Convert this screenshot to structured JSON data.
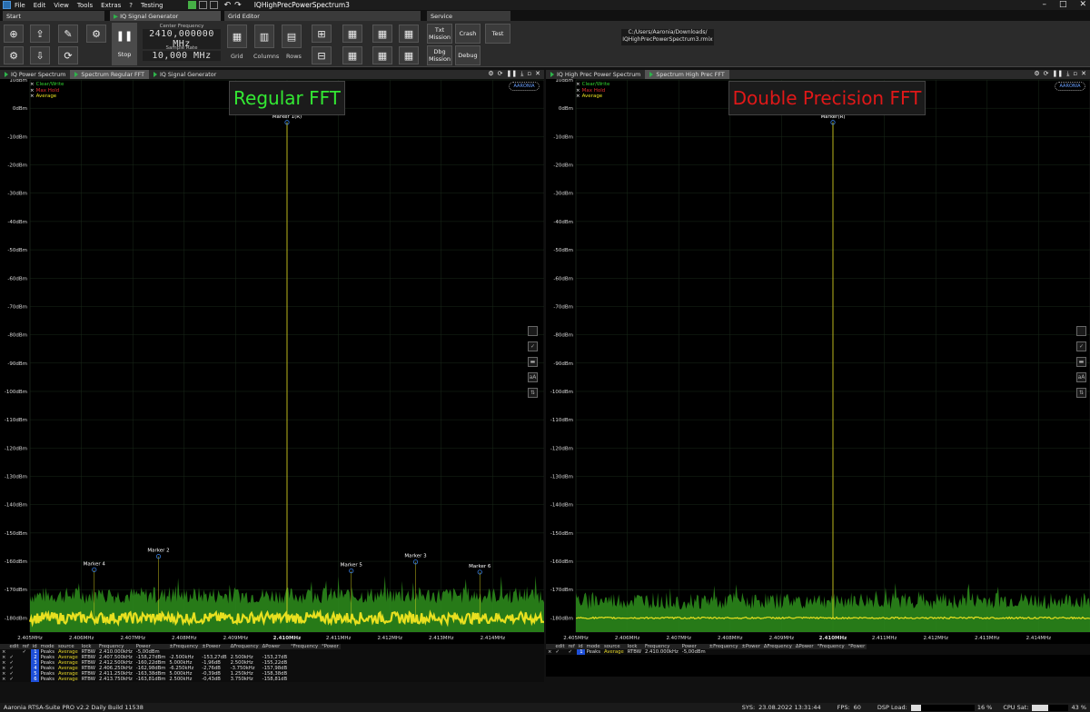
{
  "menu": {
    "items": [
      "File",
      "Edit",
      "View",
      "Tools",
      "Extras",
      "?",
      "Testing"
    ],
    "doc_title": "IQHighPrecPowerSpectrum3"
  },
  "ribbon_tabs": {
    "start": "Start",
    "iq_signal_generator": "IQ Signal Generator",
    "grid_editor": "Grid Editor",
    "service": "Service"
  },
  "ribbon": {
    "stop_label": "Stop",
    "center_frequency_label": "Center Frequency",
    "center_frequency_value": "2410,000000 MHz",
    "sample_rate_label": "Sample Rate",
    "sample_rate_value": "10,000 MHz",
    "grid_label": "Grid",
    "columns_label": "Columns",
    "rows_label": "Rows",
    "txt_mission": "Txt Mission",
    "crash": "Crash",
    "test": "Test",
    "dbg_mission": "Dbg Mission",
    "debug": "Debug",
    "path_line1": "C:/Users/Aaronia/Downloads/",
    "path_line2": "IQHighPrecPowerSpectrum3.rmix"
  },
  "left_panel": {
    "tabs": [
      "IQ Power Spectrum",
      "Spectrum Regular FFT",
      "IQ Signal Generator"
    ],
    "active_tab": 1,
    "banner": "Regular FFT",
    "banner_color": "#33e833"
  },
  "right_panel": {
    "tabs": [
      "IQ High Prec Power Spectrum",
      "Spectrum High Prec FFT"
    ],
    "active_tab": 1,
    "banner": "Double Precision FFT",
    "banner_color": "#e01818"
  },
  "legend": {
    "clear_write": "Clear/Write",
    "max_hold": "Max Hold",
    "average": "Average"
  },
  "logo_text": "AARONIA",
  "chart_data": [
    {
      "type": "line",
      "title": "Regular FFT",
      "xlabel": "",
      "ylabel": "",
      "x_ticks": [
        "2.405MHz",
        "2.406MHz",
        "2.407MHz",
        "2.408MHz",
        "2.409MHz",
        "2.410MHz",
        "2.411MHz",
        "2.412MHz",
        "2.413MHz",
        "2.414MHz"
      ],
      "y_ticks": [
        "10dBm",
        "0dBm",
        "-10dBm",
        "-20dBm",
        "-30dBm",
        "-40dBm",
        "-50dBm",
        "-60dBm",
        "-70dBm",
        "-80dBm",
        "-90dBm",
        "-100dBm",
        "-110dBm",
        "-120dBm",
        "-130dBm",
        "-140dBm",
        "-150dBm",
        "-160dBm",
        "-170dBm",
        "-180dBm"
      ],
      "xlim": [
        2405,
        2415
      ],
      "ylim": [
        -185,
        10
      ],
      "series": [
        {
          "name": "Max Hold",
          "color": "#2e8f1c",
          "noise_floor_dbm": -172
        },
        {
          "name": "Average",
          "color": "#e8e020",
          "noise_floor_dbm": -180,
          "peak": {
            "x": 2410.0,
            "y": -5
          }
        }
      ],
      "markers": [
        {
          "label": "Marker 1(R)",
          "x": 2410.0,
          "y": -5.0
        },
        {
          "label": "Marker 2",
          "x": 2407.5,
          "y": -158.27
        },
        {
          "label": "Marker 3",
          "x": 2412.5,
          "y": -160.22
        },
        {
          "label": "Marker 4",
          "x": 2406.25,
          "y": -162.98
        },
        {
          "label": "Marker 5",
          "x": 2411.25,
          "y": -163.38
        },
        {
          "label": "Marker 6",
          "x": 2413.75,
          "y": -163.81
        }
      ],
      "grid": true
    },
    {
      "type": "line",
      "title": "Double Precision FFT",
      "xlabel": "",
      "ylabel": "",
      "x_ticks": [
        "2.405MHz",
        "2.406MHz",
        "2.407MHz",
        "2.408MHz",
        "2.409MHz",
        "2.410MHz",
        "2.411MHz",
        "2.412MHz",
        "2.413MHz",
        "2.414MHz"
      ],
      "y_ticks": [
        "10dBm",
        "0dBm",
        "-10dBm",
        "-20dBm",
        "-30dBm",
        "-40dBm",
        "-50dBm",
        "-60dBm",
        "-70dBm",
        "-80dBm",
        "-90dBm",
        "-100dBm",
        "-110dBm",
        "-120dBm",
        "-130dBm",
        "-140dBm",
        "-150dBm",
        "-160dBm",
        "-170dBm",
        "-180dBm"
      ],
      "xlim": [
        2405,
        2415
      ],
      "ylim": [
        -185,
        10
      ],
      "series": [
        {
          "name": "Max Hold",
          "color": "#2e8f1c",
          "noise_floor_dbm": -174
        },
        {
          "name": "Average",
          "color": "#e8e020",
          "noise_floor_dbm": -180,
          "peak": {
            "x": 2410.0,
            "y": -5
          }
        }
      ],
      "markers": [
        {
          "label": "Marker(R)",
          "x": 2410.0,
          "y": -5.0
        }
      ],
      "grid": true
    }
  ],
  "marker_table_left": {
    "headers": [
      "",
      "edit",
      "ref",
      "id",
      "mode",
      "source",
      "lock",
      "Frequency",
      "Power",
      "±Frequency",
      "±Power",
      "ΔFrequency",
      "ΔPower",
      "°Frequency",
      "°Power"
    ],
    "rows": [
      [
        "×",
        "",
        "✓",
        "1",
        "Peaks",
        "Average",
        "RTBW",
        "2.410.000kHz",
        "-5,00dBm",
        "",
        "",
        "",
        "",
        "",
        ""
      ],
      [
        "×",
        "✓",
        "",
        "2",
        "Peaks",
        "Average",
        "RTBW",
        "2.407.500kHz",
        "-158,27dBm",
        "-2.500kHz",
        "-153,27dB",
        "2.500kHz",
        "-153,27dB",
        "",
        ""
      ],
      [
        "×",
        "✓",
        "",
        "3",
        "Peaks",
        "Average",
        "RTBW",
        "2.412.500kHz",
        "-160,22dBm",
        "5.000kHz",
        "-1,96dB",
        "2.500kHz",
        "-155,22dB",
        "",
        ""
      ],
      [
        "×",
        "✓",
        "",
        "4",
        "Peaks",
        "Average",
        "RTBW",
        "2.406.250kHz",
        "-162,98dBm",
        "-6.250kHz",
        "-2,76dB",
        "-3.750kHz",
        "-157,98dB",
        "",
        ""
      ],
      [
        "×",
        "✓",
        "",
        "5",
        "Peaks",
        "Average",
        "RTBW",
        "2.411.250kHz",
        "-163,38dBm",
        "5.000kHz",
        "-0,39dB",
        "1.250kHz",
        "-158,38dB",
        "",
        ""
      ],
      [
        "×",
        "✓",
        "",
        "6",
        "Peaks",
        "Average",
        "RTBW",
        "2.413.750kHz",
        "-163,81dBm",
        "2.500kHz",
        "-0,43dB",
        "3.750kHz",
        "-158,81dB",
        "",
        ""
      ]
    ]
  },
  "marker_table_right": {
    "headers": [
      "",
      "edit",
      "ref",
      "id",
      "mode",
      "source",
      "lock",
      "Frequency",
      "Power",
      "±Frequency",
      "±Power",
      "ΔFrequency",
      "ΔPower",
      "°Frequency",
      "°Power"
    ],
    "rows": [
      [
        "×",
        "✓",
        "✓",
        "1",
        "Peaks",
        "Average",
        "RTBW",
        "2.410.000kHz",
        "-5,00dBm",
        "",
        "",
        "",
        "",
        "",
        ""
      ]
    ]
  },
  "status": {
    "app": "Aaronia RTSA-Suite PRO v2.2 Daily Build 11538",
    "sys_label": "SYS:",
    "sys_time": "23.08.2022 13:31:44",
    "fps_label": "FPS:",
    "fps": "60",
    "dsp_label": "DSP Load:",
    "dsp_value": "16 %",
    "dsp_fraction": 0.16,
    "cpu_label": "CPU Sat:",
    "cpu_value": "43 %",
    "cpu_fraction": 0.43
  }
}
